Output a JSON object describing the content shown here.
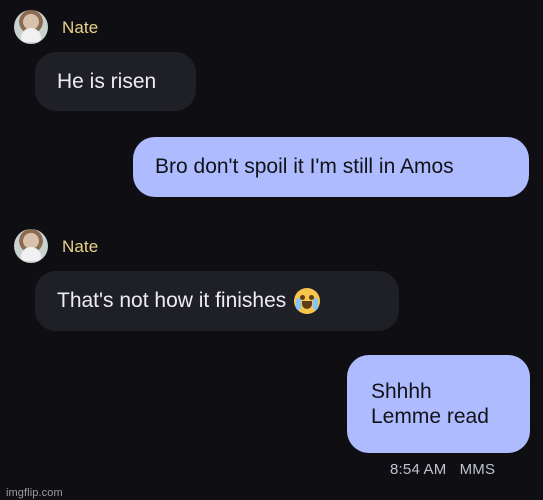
{
  "conversation": {
    "messages": [
      {
        "sender": "Nate",
        "text": "He is risen"
      },
      {
        "text": "Bro don't spoil it I'm still in Amos"
      },
      {
        "sender": "Nate",
        "text": "That's not how it finishes",
        "emoji": "crying-face-icon"
      },
      {
        "lines": [
          "Shhhh",
          "Lemme read"
        ]
      }
    ],
    "status": {
      "time": "8:54 AM",
      "type": "MMS"
    }
  },
  "watermark": {
    "text": "imgflip.com"
  },
  "colors": {
    "background": "#0f0f13",
    "incoming_bubble": "#1f2026",
    "outgoing_bubble": "#aebcff",
    "sender_name": "#ead38a"
  }
}
